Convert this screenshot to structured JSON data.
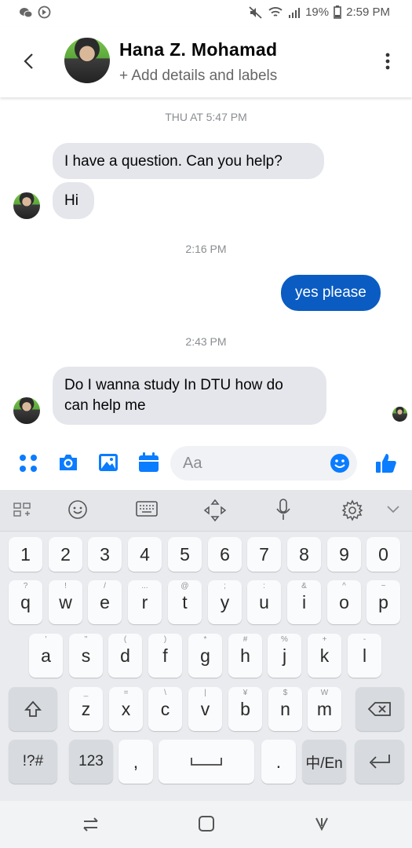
{
  "status_bar": {
    "battery": "19%",
    "time": "2:59 PM"
  },
  "header": {
    "contact_name": "Hana Z. Mohamad",
    "subtitle": "+ Add details and labels"
  },
  "messages": {
    "ts1": "THU AT 5:47 PM",
    "in1": "I have a question. Can you help?",
    "in2": "Hi",
    "ts2": "2:16 PM",
    "out1": "yes please",
    "ts3": "2:43 PM",
    "in3_line1": "Do I wanna study In DTU how do",
    "in3_line2": "can help me"
  },
  "composer": {
    "placeholder": "Aa"
  },
  "keyboard": {
    "row_numbers": [
      "1",
      "2",
      "3",
      "4",
      "5",
      "6",
      "7",
      "8",
      "9",
      "0"
    ],
    "row1": [
      {
        "k": "q",
        "h": "?"
      },
      {
        "k": "w",
        "h": "!"
      },
      {
        "k": "e",
        "h": "/"
      },
      {
        "k": "r",
        "h": "..."
      },
      {
        "k": "t",
        "h": "@"
      },
      {
        "k": "y",
        "h": ";"
      },
      {
        "k": "u",
        "h": ":"
      },
      {
        "k": "i",
        "h": "&"
      },
      {
        "k": "o",
        "h": "^"
      },
      {
        "k": "p",
        "h": "~"
      }
    ],
    "row2": [
      {
        "k": "a",
        "h": "'"
      },
      {
        "k": "s",
        "h": "\""
      },
      {
        "k": "d",
        "h": "("
      },
      {
        "k": "f",
        "h": ")"
      },
      {
        "k": "g",
        "h": "*"
      },
      {
        "k": "h",
        "h": "#"
      },
      {
        "k": "j",
        "h": "%"
      },
      {
        "k": "k",
        "h": "+"
      },
      {
        "k": "l",
        "h": "-"
      }
    ],
    "row3": [
      {
        "k": "z",
        "h": "_"
      },
      {
        "k": "x",
        "h": "="
      },
      {
        "k": "c",
        "h": "\\"
      },
      {
        "k": "v",
        "h": "|"
      },
      {
        "k": "b",
        "h": "¥"
      },
      {
        "k": "n",
        "h": "$"
      },
      {
        "k": "m",
        "h": "W"
      }
    ],
    "symbols_label": "!?#",
    "numeric_label": "123",
    "comma": ",",
    "period": ".",
    "lang_label": "中/En"
  }
}
